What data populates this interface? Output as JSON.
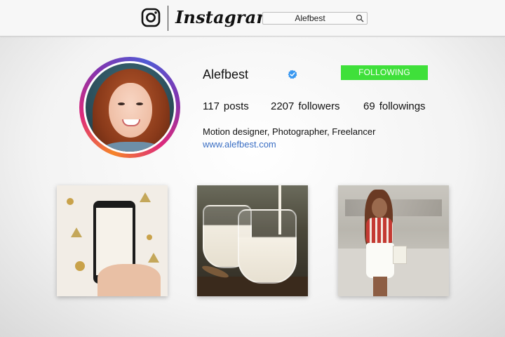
{
  "header": {
    "brand": "Instagram",
    "search_value": "Alefbest"
  },
  "profile": {
    "username": "Alefbest",
    "verified": true,
    "follow_button_label": "FOLLOWING",
    "stats": {
      "posts_count": "117",
      "posts_label": "posts",
      "followers_count": "2207",
      "followers_label": "followers",
      "followings_count": "69",
      "followings_label": "followings"
    },
    "bio": "Motion designer, Photographer, Freelancer",
    "website": "www.alefbest.com"
  },
  "colors": {
    "follow_button": "#3fe03a",
    "link": "#3b6fc4",
    "verified_badge": "#3897f0"
  },
  "icons": [
    "instagram-logo-icon",
    "search-icon",
    "verified-badge-icon"
  ],
  "posts": [
    {
      "alt": "phone-photo-flatlay"
    },
    {
      "alt": "milk-glasses"
    },
    {
      "alt": "woman-street-fashion"
    }
  ]
}
